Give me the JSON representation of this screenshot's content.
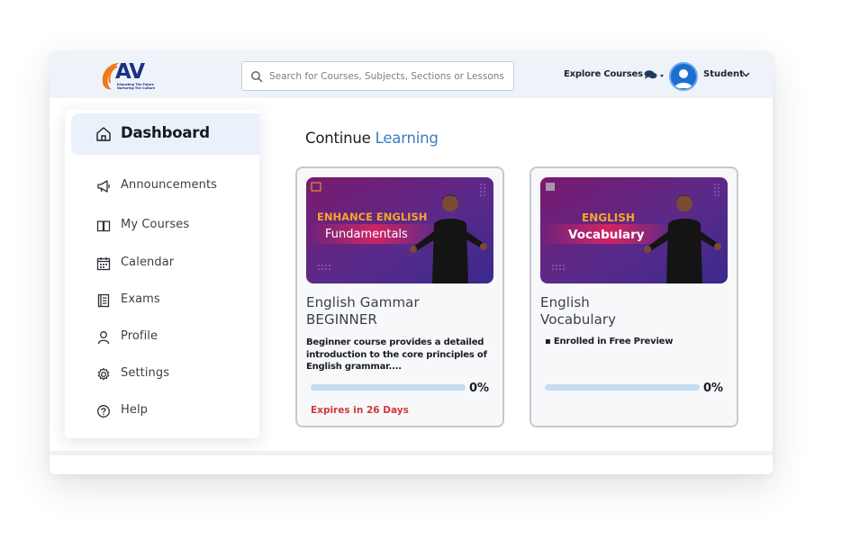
{
  "header": {
    "logo_text": "AV",
    "logo_tagline": "Educating The Future Nurturing The Culture",
    "search_placeholder": "Search for Courses, Subjects, Sections or Lessons",
    "explore_label": "Explore Courses",
    "chat_icon": "chat-bubbles-icon",
    "user_name": "Student"
  },
  "sidebar": {
    "items": [
      {
        "label": "Dashboard",
        "icon": "home-icon"
      },
      {
        "label": "Announcements",
        "icon": "megaphone-icon"
      },
      {
        "label": "My Courses",
        "icon": "book-icon"
      },
      {
        "label": "Calendar",
        "icon": "calendar-icon"
      },
      {
        "label": "Exams",
        "icon": "notebook-icon"
      },
      {
        "label": "Profile",
        "icon": "user-icon"
      },
      {
        "label": "Settings",
        "icon": "gear-icon"
      },
      {
        "label": "Help",
        "icon": "help-icon"
      }
    ]
  },
  "main": {
    "title_prefix": "Continue",
    "title_accent": "Learning",
    "cards": [
      {
        "thumb_line1": "ENHANCE ENGLISH",
        "thumb_line2": "Fundamentals",
        "title_line1": "English Gammar",
        "title_line2": "BEGINNER",
        "description": "Beginner course provides a detailed introduction to the core principles of English grammar....",
        "progress": 0,
        "progress_label": "0%",
        "expires": "Expires in 26 Days"
      },
      {
        "thumb_line1": "ENGLISH",
        "thumb_line2": "Vocabulary",
        "title_line1": "English",
        "title_line2": "Vocabulary",
        "enrolled": "Enrolled in Free Preview",
        "progress": 0,
        "progress_label": "0%"
      }
    ]
  },
  "colors": {
    "accent": "#3d7cc6",
    "header_bg": "#eef3f9",
    "expires_red": "#d23a3a",
    "thumb_purple": "#6a2a8c",
    "thumb_orange": "#f6a52b",
    "logo_navy": "#1e2f86",
    "logo_orange": "#ef7a1c"
  }
}
